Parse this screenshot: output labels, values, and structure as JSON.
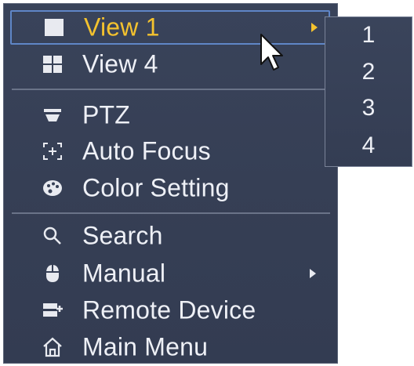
{
  "menu": {
    "items": [
      {
        "label": "View 1",
        "icon": "single-view-icon",
        "has_submenu": true,
        "selected": true
      },
      {
        "label": "View 4",
        "icon": "quad-view-icon",
        "has_submenu": false
      },
      {
        "label": "PTZ",
        "icon": "ptz-camera-icon",
        "has_submenu": false
      },
      {
        "label": "Auto Focus",
        "icon": "auto-focus-icon",
        "has_submenu": false
      },
      {
        "label": "Color Setting",
        "icon": "palette-icon",
        "has_submenu": false
      },
      {
        "label": "Search",
        "icon": "search-icon",
        "has_submenu": false
      },
      {
        "label": "Manual",
        "icon": "mouse-icon",
        "has_submenu": true
      },
      {
        "label": "Remote Device",
        "icon": "remote-device-icon",
        "has_submenu": false
      },
      {
        "label": "Main Menu",
        "icon": "home-icon",
        "has_submenu": false
      }
    ]
  },
  "submenu": {
    "items": [
      "1",
      "2",
      "3",
      "4"
    ]
  },
  "colors": {
    "background": "#363f55",
    "selected_text": "#f4c22e",
    "selected_border": "#5f86c7",
    "text": "#eef0f6"
  }
}
